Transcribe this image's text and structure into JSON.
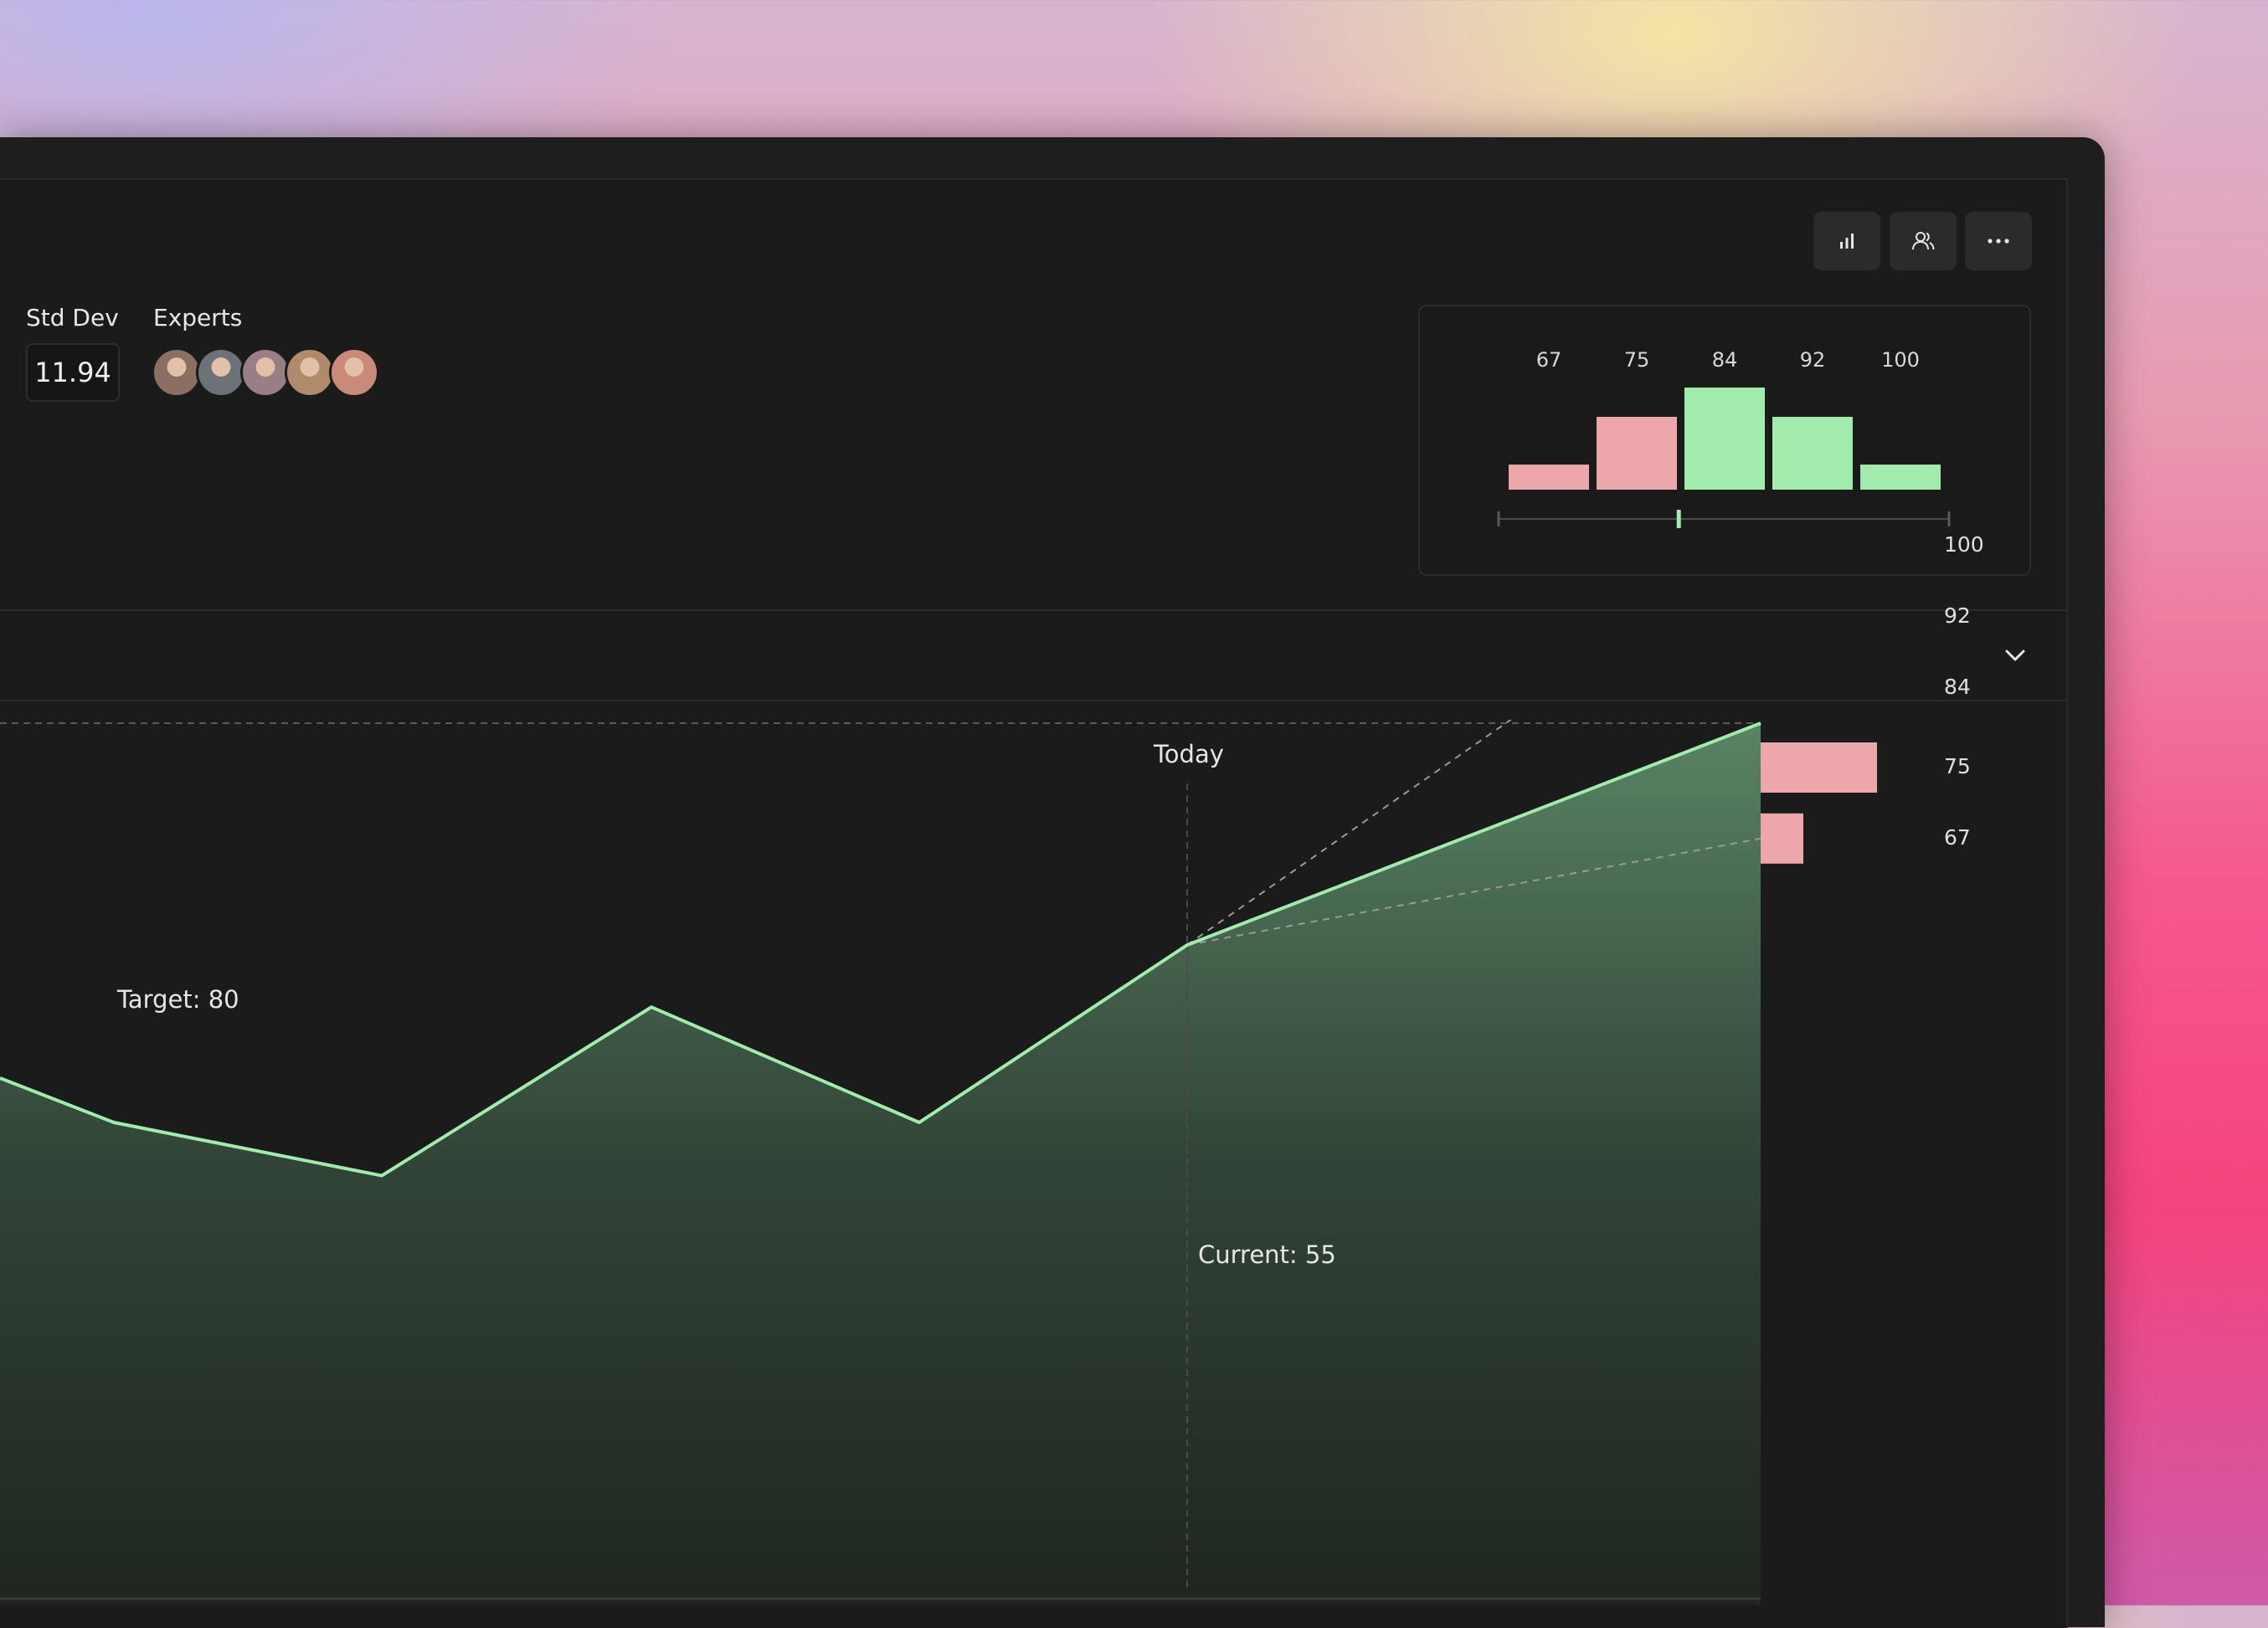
{
  "stats": {
    "std_dev_label": "Std Dev",
    "std_dev_value": "11.94",
    "experts_label": "Experts",
    "expert_avatars": [
      {
        "name": "expert-avatar-1",
        "color": "#8c6f63"
      },
      {
        "name": "expert-avatar-2",
        "color": "#6d7278"
      },
      {
        "name": "expert-avatar-3",
        "color": "#9a7e86"
      },
      {
        "name": "expert-avatar-4",
        "color": "#b08a6a"
      },
      {
        "name": "expert-avatar-5",
        "color": "#c98a78"
      }
    ]
  },
  "toolbar": {
    "buttons": [
      {
        "name": "bar-chart-icon"
      },
      {
        "name": "users-icon"
      },
      {
        "name": "more-icon"
      }
    ]
  },
  "histogram": {
    "labels": [
      "67",
      "75",
      "84",
      "92",
      "100"
    ],
    "bars": [
      {
        "label": "67",
        "level": 0.25,
        "color": "#eda7ab"
      },
      {
        "label": "75",
        "level": 0.71,
        "color": "#eda7ab"
      },
      {
        "label": "84",
        "level": 1.0,
        "color": "#a1ebad"
      },
      {
        "label": "92",
        "level": 0.71,
        "color": "#a1ebad"
      },
      {
        "label": "100",
        "level": 0.25,
        "color": "#a1ebad"
      }
    ],
    "slider_position": 0.4
  },
  "chart_data": {
    "type": "area",
    "today_label": "Today",
    "target_label": "Target: 80",
    "target": 80,
    "current_label": "Current: 55",
    "current": 55,
    "line_color": "#a1ebad",
    "series": [
      {
        "values": [
          40,
          35,
          29,
          48,
          35,
          55,
          80
        ]
      }
    ],
    "projections": [
      {
        "label": "100",
        "value": 100,
        "level": 0.26,
        "color": "#a1ebad"
      },
      {
        "label": "92",
        "value": 92,
        "level": 0.71,
        "color": "#a1ebad"
      },
      {
        "label": "84",
        "value": 84,
        "level": 1.0,
        "color": "#a1ebad"
      },
      {
        "label": "75",
        "value": 75,
        "level": 0.71,
        "color": "#eda7ab"
      },
      {
        "label": "67",
        "value": 67,
        "level": 0.26,
        "color": "#eda7ab"
      }
    ],
    "ylim": [
      0,
      120
    ]
  }
}
